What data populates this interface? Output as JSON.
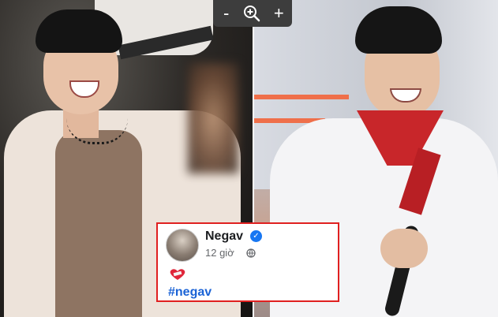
{
  "viewer": {
    "zoom_out_label": "-",
    "zoom_in_label": "+",
    "zoom_icon": "magnifier-plus-icon"
  },
  "post": {
    "author": "Negav",
    "verified": true,
    "time": "12 giờ",
    "privacy_icon": "globe-icon",
    "emoji": "heart-bandaged-emoji",
    "hashtag": "#negav"
  },
  "colors": {
    "card_border": "#e02020",
    "verified_badge": "#1877f2",
    "hashtag": "#1b63d6"
  }
}
